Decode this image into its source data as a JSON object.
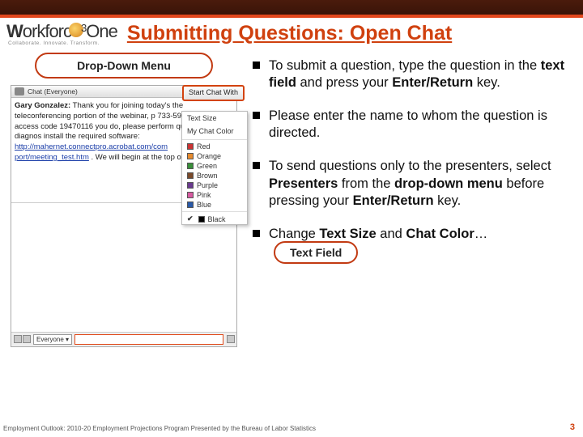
{
  "logo": {
    "name": "Workforce One",
    "tagline": "Collaborate.  Innovate.  Transform."
  },
  "slide_title": "Submitting Questions: Open Chat",
  "dropdown_label": "Drop-Down Menu",
  "textfield_label": "Text Field",
  "chat": {
    "header": "Chat  (Everyone)",
    "message_author": "Gary Gonzalez:",
    "message_body": "Thank you for joining today's the teleconferencing portion of the webinar, p 733-5945 followed by access code 19470116 you do, please perform quick system diagnos install the required software:",
    "message_link": "http://mahernet.connectpro.acrobat.com/com port/meeting_test.htm",
    "message_tail": " . We will begin at the top of the hour.",
    "dropdown_value": "Everyone",
    "start_button": "Start Chat With"
  },
  "menu": {
    "item1": "Text Size",
    "item2": "My Chat Color",
    "colors": [
      {
        "name": "Red",
        "hex": "#c33"
      },
      {
        "name": "Orange",
        "hex": "#e68a2e"
      },
      {
        "name": "Green",
        "hex": "#3a8f3a"
      },
      {
        "name": "Brown",
        "hex": "#7a4a2a"
      },
      {
        "name": "Purple",
        "hex": "#6a3a8f"
      },
      {
        "name": "Pink",
        "hex": "#d65aa0"
      },
      {
        "name": "Blue",
        "hex": "#2a5aa8"
      },
      {
        "name": "Black",
        "hex": "#000"
      }
    ]
  },
  "bullets": {
    "b1_pre": "To submit a question, type the question in the ",
    "b1_bold1": "text field",
    "b1_mid": " and press your ",
    "b1_bold2": "Enter/Return",
    "b1_post": " key.",
    "b2": "Please enter the name to whom the question is directed.",
    "b3_pre": "To send questions only to the presenters, select ",
    "b3_bold1": "Presenters",
    "b3_mid1": " from the ",
    "b3_bold2": "drop-down menu",
    "b3_mid2": " before pressing your ",
    "b3_bold3": "Enter/Return",
    "b3_post": " key.",
    "b4_pre": "Change ",
    "b4_bold1": "Text Size",
    "b4_mid": " and ",
    "b4_bold2": "Chat Color",
    "b4_post": "…"
  },
  "footer": "Employment Outlook: 2010-20 Employment Projections Program Presented by the Bureau of Labor Statistics",
  "page_number": "3"
}
